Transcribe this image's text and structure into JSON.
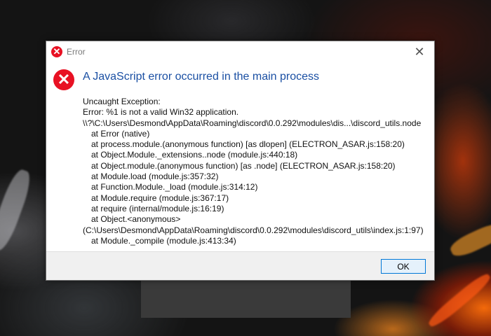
{
  "dialog": {
    "title": "Error",
    "heading": "A JavaScript error occurred in the main process",
    "details": [
      {
        "text": "Uncaught Exception:",
        "indent": false
      },
      {
        "text": "Error: %1 is not a valid Win32 application.",
        "indent": false
      },
      {
        "text": "\\\\?\\C:\\Users\\Desmond\\AppData\\Roaming\\discord\\0.0.292\\modules\\dis...\\discord_utils.node",
        "indent": false
      },
      {
        "text": "at Error (native)",
        "indent": true
      },
      {
        "text": "at process.module.(anonymous function) [as dlopen] (ELECTRON_ASAR.js:158:20)",
        "indent": true
      },
      {
        "text": "at Object.Module._extensions..node (module.js:440:18)",
        "indent": true
      },
      {
        "text": "at Object.module.(anonymous function) [as .node] (ELECTRON_ASAR.js:158:20)",
        "indent": true
      },
      {
        "text": "at Module.load (module.js:357:32)",
        "indent": true
      },
      {
        "text": "at Function.Module._load (module.js:314:12)",
        "indent": true
      },
      {
        "text": "at Module.require (module.js:367:17)",
        "indent": true
      },
      {
        "text": "at require (internal/module.js:16:19)",
        "indent": true
      },
      {
        "text": "at Object.<anonymous>",
        "indent": true
      },
      {
        "text": "(C:\\Users\\Desmond\\AppData\\Roaming\\discord\\0.0.292\\modules\\discord_utils\\index.js:1:97)",
        "indent": false
      },
      {
        "text": "at Module._compile (module.js:413:34)",
        "indent": true
      }
    ],
    "ok_label": "OK",
    "close_glyph": "✕",
    "error_glyph": "✕",
    "icons": {
      "title": "error-icon",
      "main": "error-icon",
      "close": "close-icon"
    },
    "colors": {
      "error_red": "#e81123",
      "heading_blue": "#1a4fa3",
      "button_border": "#0078d7"
    }
  }
}
